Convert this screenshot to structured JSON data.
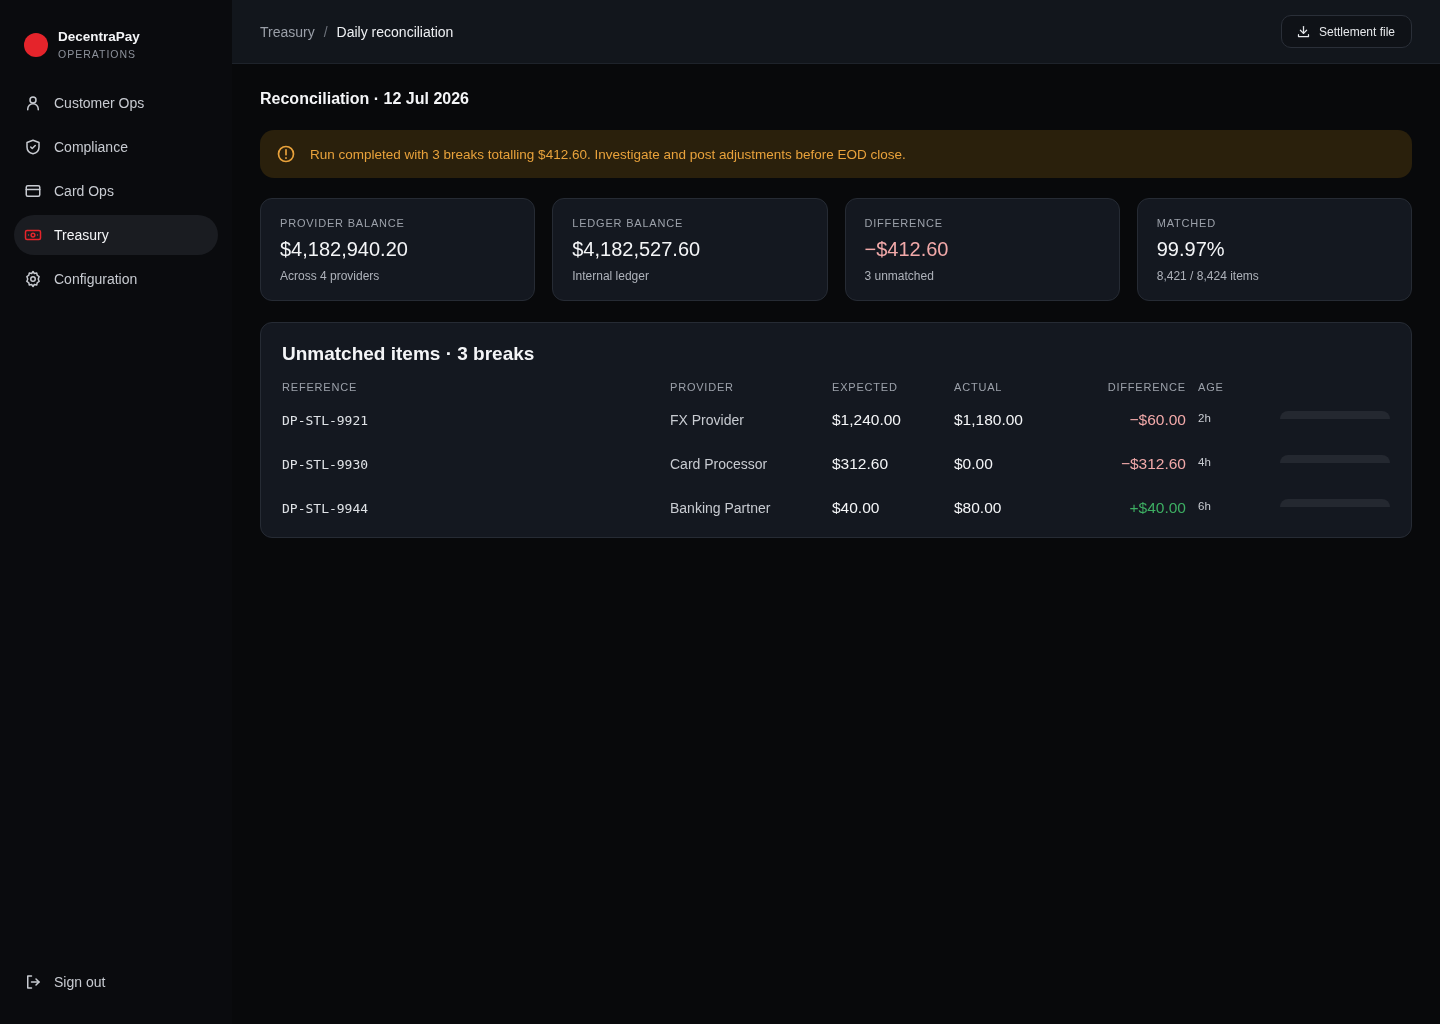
{
  "sidebar": {
    "brand": {
      "name": "DecentraPay",
      "subtitle": "OPERATIONS"
    },
    "items": [
      {
        "label": "Customer Ops",
        "selected": false
      },
      {
        "label": "Compliance",
        "selected": false
      },
      {
        "label": "Card Ops",
        "selected": false
      },
      {
        "label": "Treasury",
        "selected": true
      },
      {
        "label": "Configuration",
        "selected": false
      }
    ],
    "footer": {
      "label": "Sign out"
    }
  },
  "topbar": {
    "breadcrumb": [
      "Treasury",
      "Daily reconciliation"
    ],
    "separator": "/",
    "button": "Settlement file"
  },
  "page": {
    "title": "Reconciliation · 12 Jul 2026"
  },
  "alert": {
    "text": "Run completed with 3 breaks totalling $412.60. Investigate and post adjustments before EOD close."
  },
  "stats": [
    {
      "label": "PROVIDER BALANCE",
      "value": "$4,182,940.20",
      "note": "Across 4 providers",
      "color": "#f4f5f7"
    },
    {
      "label": "LEDGER BALANCE",
      "value": "$4,182,527.60",
      "note": "Internal ledger",
      "color": "#f4f5f7"
    },
    {
      "label": "DIFFERENCE",
      "value": "−$412.60",
      "note": "3 unmatched",
      "color": "#f2a9a9"
    },
    {
      "label": "MATCHED",
      "value": "99.97%",
      "note": "8,421 / 8,424 items",
      "color": "#f4f5f7"
    }
  ],
  "table": {
    "title": "Unmatched items · 3 breaks",
    "columns": [
      "REFERENCE",
      "PROVIDER",
      "EXPECTED",
      "ACTUAL",
      "DIFFERENCE",
      "AGE"
    ],
    "rows": [
      {
        "reference": "DP-STL-9921",
        "provider": "FX Provider",
        "expected": "$1,240.00",
        "actual": "$1,180.00",
        "difference": "−$60.00",
        "color": "#f2a9a9",
        "age": "2h"
      },
      {
        "reference": "DP-STL-9930",
        "provider": "Card Processor",
        "expected": "$312.60",
        "actual": "$0.00",
        "difference": "−$312.60",
        "color": "#f2a9a9",
        "age": "4h"
      },
      {
        "reference": "DP-STL-9944",
        "provider": "Banking Partner",
        "expected": "$40.00",
        "actual": "$80.00",
        "difference": "+$40.00",
        "color": "#3dae62",
        "age": "6h"
      }
    ]
  }
}
